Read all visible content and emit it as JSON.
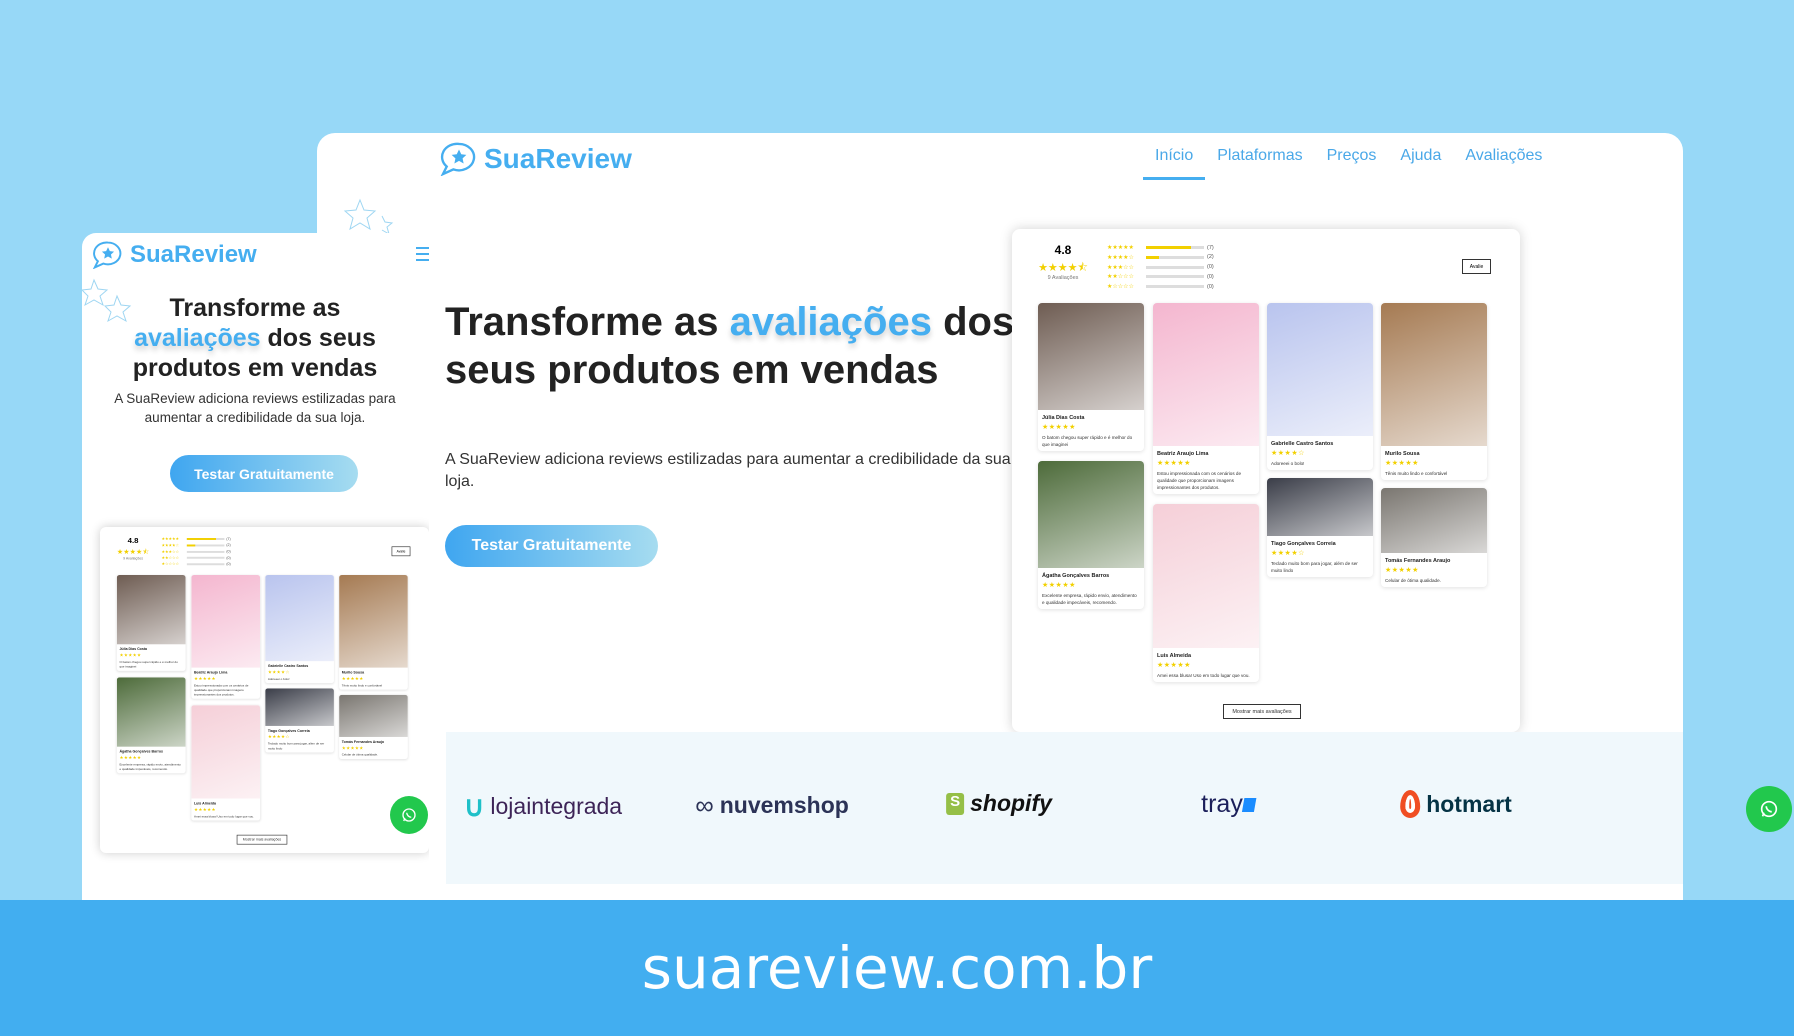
{
  "brand": "SuaReview",
  "nav": [
    {
      "label": "Início",
      "active": true
    },
    {
      "label": "Plataformas"
    },
    {
      "label": "Preços"
    },
    {
      "label": "Ajuda"
    },
    {
      "label": "Avaliações"
    }
  ],
  "hero": {
    "prefix": "Transforme as ",
    "highlight": "avaliações",
    "suffix": " dos seus produtos em vendas",
    "paragraph": "A SuaReview adiciona reviews estilizadas para aumentar a credibilidade da sua loja.",
    "cta": "Testar Gratuitamente"
  },
  "widget": {
    "average": "4.8",
    "average_stars": "★★★★⯪",
    "count_label": "9 Avaliações",
    "distribution": [
      {
        "stars": "★★★★★",
        "count": "(7)",
        "fraction": 0.78
      },
      {
        "stars": "★★★★☆",
        "count": "(2)",
        "fraction": 0.22
      },
      {
        "stars": "★★★☆☆",
        "count": "(0)",
        "fraction": 0
      },
      {
        "stars": "★★☆☆☆",
        "count": "(0)",
        "fraction": 0
      },
      {
        "stars": "★☆☆☆☆",
        "count": "(0)",
        "fraction": 0
      }
    ],
    "rate_button": "Avalie",
    "more_button": "Mostrar mais avaliações",
    "reviews": [
      {
        "name": "Júlia Dias Costa",
        "stars": "★★★★★",
        "text": "O batom chegou super rápido e é melhor do que imaginei",
        "image": "lipstick-photo",
        "color": "#6e5c52"
      },
      {
        "name": "Beatriz Araujo Lima",
        "stars": "★★★★★",
        "text": "Estou impressionada com os cenários de qualidade que proporcionam imagens impressionantes dos produtos.",
        "image": "cosmetics-photo",
        "color": "#f4b6cf"
      },
      {
        "name": "Gabrielle Castro Santos",
        "stars": "★★★★☆",
        "text": "Adoreeei o bolo!",
        "image": "cake-photo",
        "color": "#b9c4ee"
      },
      {
        "name": "Murilo Sousa",
        "stars": "★★★★★",
        "text": "Tênis muito lindo e confortável",
        "image": "sneakers-photo",
        "color": "#a57a52"
      },
      {
        "name": "Ágatha Gonçalves Barros",
        "stars": "★★★★★",
        "text": "Excelente empresa, rápido envio, atendimento e qualidade impecáveis, recomendo.",
        "image": "bicycle-photo",
        "color": "#4d6b3a"
      },
      {
        "name": "Luis Almeida",
        "stars": "★★★★★",
        "text": "Amei essa blusa! Uso em todo lugar que vou.",
        "image": "sweater-photo",
        "color": "#f5cfd8"
      },
      {
        "name": "Tiago Gonçalves Correia",
        "stars": "★★★★☆",
        "text": "Teclado muito bom para jogar, além de ser muito lindo",
        "image": "keyboard-photo",
        "color": "#3a3d48"
      },
      {
        "name": "Tomás Fernandes Araujo",
        "stars": "★★★★★",
        "text": "Celular de ótima qualidade.",
        "image": "phone-photo",
        "color": "#7a7670"
      }
    ]
  },
  "platforms": [
    {
      "name": "lojaintegrada",
      "color": "#3d2457",
      "icon_color": "#1fc0c8"
    },
    {
      "name": "nuvemshop",
      "color": "#2c3357",
      "icon_color": "#2c3357"
    },
    {
      "name": "shopify",
      "color": "#111111",
      "icon_color": "#95bf47"
    },
    {
      "name": "tray",
      "color": "#1b1f5a",
      "icon_color": "#1a8cff"
    },
    {
      "name": "hotmart",
      "color": "#053345",
      "icon_color": "#f04e23"
    }
  ],
  "footer": {
    "domain": "suareview.com.br"
  }
}
